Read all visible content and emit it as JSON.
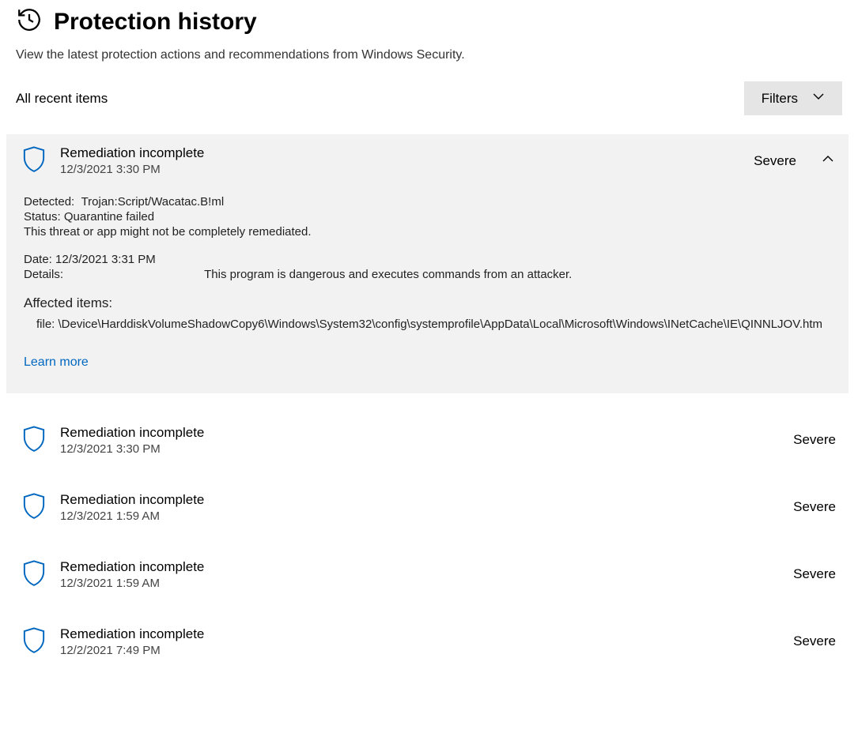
{
  "header": {
    "title": "Protection history",
    "subtitle": "View the latest protection actions and recommendations from Windows Security."
  },
  "listHeader": {
    "sectionLabel": "All recent items",
    "filtersLabel": "Filters"
  },
  "expanded": {
    "title": "Remediation incomplete",
    "timestamp": "12/3/2021 3:30 PM",
    "severity": "Severe",
    "detectedLabel": "Detected:",
    "detectedValue": "Trojan:Script/Wacatac.B!ml",
    "statusLabel": "Status:",
    "statusValue": "Quarantine failed",
    "statusNote": "This threat or app might not be completely remediated.",
    "dateLabel": "Date:",
    "dateValue": "12/3/2021 3:31 PM",
    "detailsLabel": "Details:",
    "detailsValue": "This program is dangerous and executes commands from an attacker.",
    "affectedHeading": "Affected items:",
    "filePath": "file: \\Device\\HarddiskVolumeShadowCopy6\\Windows\\System32\\config\\systemprofile\\AppData\\Local\\Microsoft\\Windows\\INetCache\\IE\\QINNLJOV.htm",
    "learnMore": "Learn more"
  },
  "items": [
    {
      "title": "Remediation incomplete",
      "timestamp": "12/3/2021 3:30 PM",
      "severity": "Severe"
    },
    {
      "title": "Remediation incomplete",
      "timestamp": "12/3/2021 1:59 AM",
      "severity": "Severe"
    },
    {
      "title": "Remediation incomplete",
      "timestamp": "12/3/2021 1:59 AM",
      "severity": "Severe"
    },
    {
      "title": "Remediation incomplete",
      "timestamp": "12/2/2021 7:49 PM",
      "severity": "Severe"
    }
  ]
}
